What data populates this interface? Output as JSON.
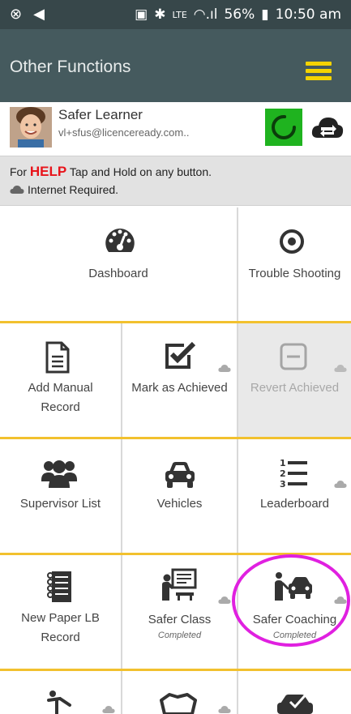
{
  "status_bar": {
    "battery": "56%",
    "time": "10:50 am"
  },
  "header": {
    "title": "Other Functions"
  },
  "profile": {
    "name": "Safer Learner",
    "email": "vl+sfus@licenceready.com.."
  },
  "help": {
    "prefix": "For ",
    "help_word": "HELP",
    "suffix": " Tap and Hold on any button.",
    "internet_note": "Internet Required."
  },
  "tiles": {
    "dashboard": "Dashboard",
    "trouble_shooting": "Trouble Shooting",
    "add_manual_record_1": "Add Manual",
    "add_manual_record_2": "Record",
    "mark_as_achieved": "Mark as Achieved",
    "revert_achieved": "Revert Achieved",
    "supervisor_list": "Supervisor List",
    "vehicles": "Vehicles",
    "leaderboard": "Leaderboard",
    "new_paper_lb_1": "New Paper LB",
    "new_paper_lb_2": "Record",
    "safer_class": "Safer Class",
    "safer_class_status": "Completed",
    "safer_coaching": "Safer Coaching",
    "safer_coaching_status": "Completed"
  },
  "colors": {
    "app_bar": "#455a5e",
    "accent_yellow": "#f5d300",
    "sync_green": "#1fb31f",
    "help_red": "#e8141b",
    "highlight_magenta": "#e020e0"
  }
}
